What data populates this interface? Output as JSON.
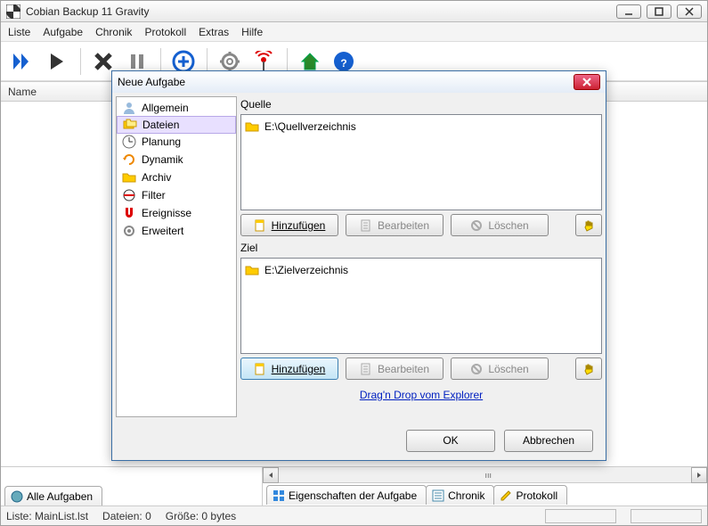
{
  "window": {
    "title": "Cobian Backup 11 Gravity"
  },
  "menu": {
    "items": [
      "Liste",
      "Aufgabe",
      "Chronik",
      "Protokoll",
      "Extras",
      "Hilfe"
    ]
  },
  "listHeader": "Name",
  "bottomTabs": {
    "left": "Alle Aufgaben",
    "right": [
      "Eigenschaften der Aufgabe",
      "Chronik",
      "Protokoll"
    ]
  },
  "status": {
    "list": "Liste: MainList.lst",
    "files": "Dateien: 0",
    "size": "Größe: 0 bytes"
  },
  "dialog": {
    "title": "Neue Aufgabe",
    "sidebar": [
      "Allgemein",
      "Dateien",
      "Planung",
      "Dynamik",
      "Archiv",
      "Filter",
      "Ereignisse",
      "Erweitert"
    ],
    "source": {
      "label": "Quelle",
      "items": [
        "E:\\Quellverzeichnis"
      ]
    },
    "dest": {
      "label": "Ziel",
      "items": [
        "E:\\Zielverzeichnis"
      ]
    },
    "btns": {
      "add": "Hinzufügen",
      "edit": "Bearbeiten",
      "del": "Löschen"
    },
    "dragLink": "Drag'n Drop vom Explorer",
    "ok": "OK",
    "cancel": "Abbrechen"
  }
}
